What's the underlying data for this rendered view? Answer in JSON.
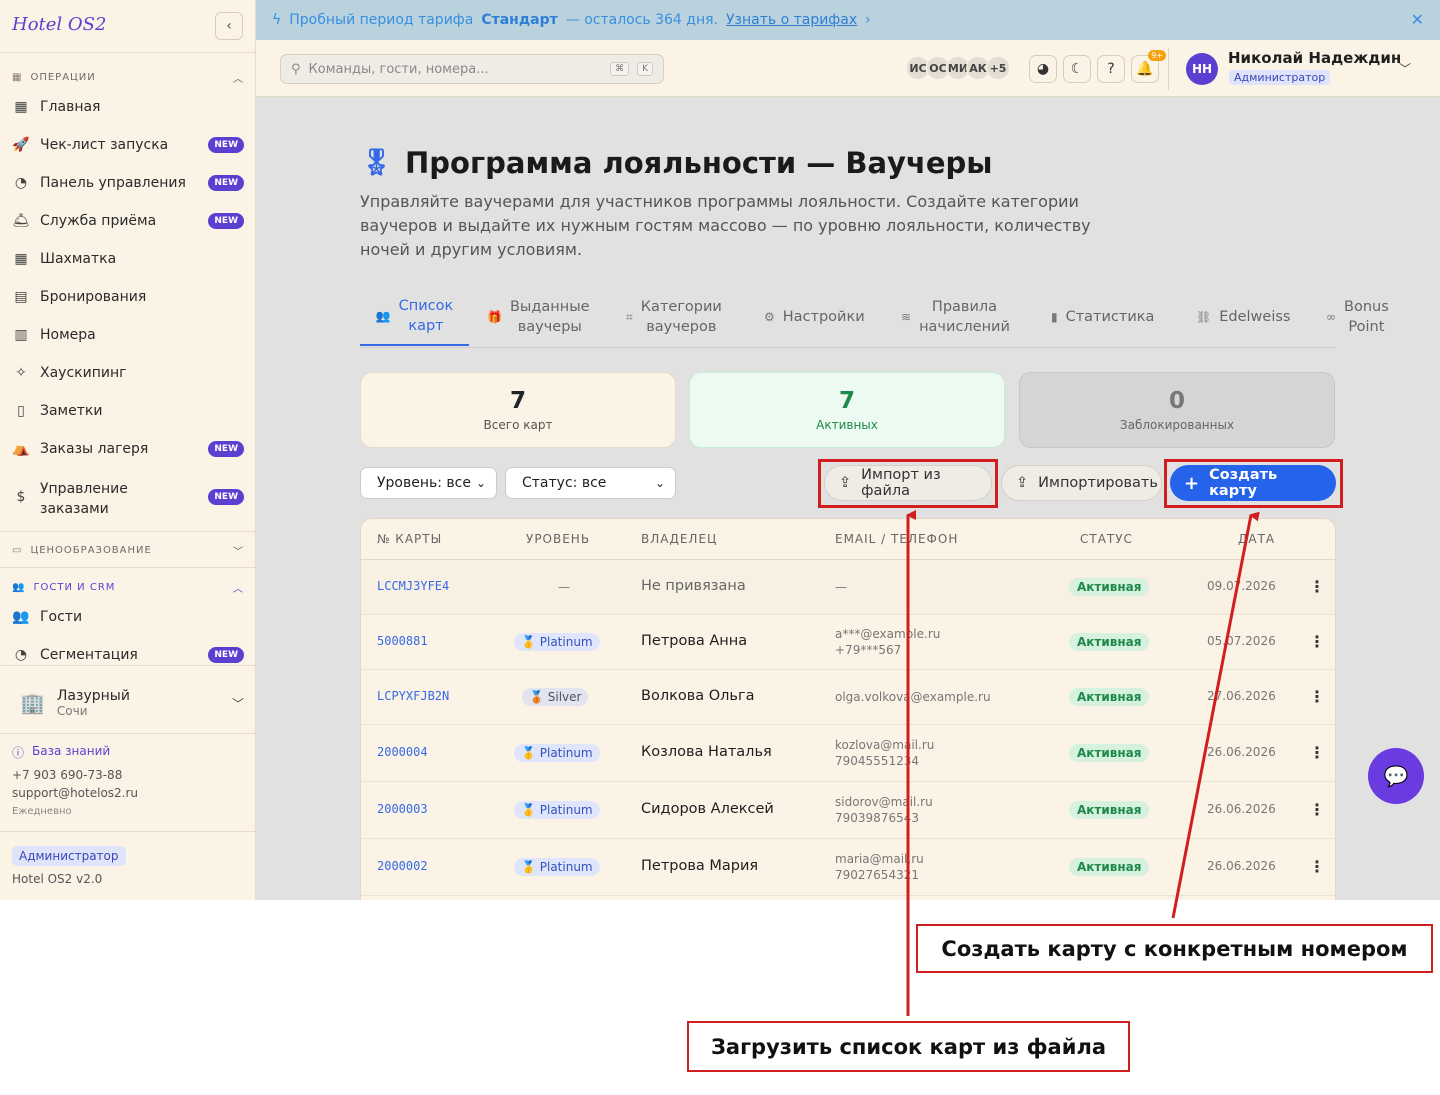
{
  "sidebar": {
    "logo": "Hotel OS2",
    "collapse_icon": "‹",
    "sections": {
      "operations": "ОПЕРАЦИИ",
      "pricing": "ЦЕНООБРАЗОВАНИЕ",
      "guests_crm": "ГОСТИ И CRM"
    },
    "items": [
      {
        "label": "Главная",
        "icon": "grid-icon",
        "badge": ""
      },
      {
        "label": "Чек-лист запуска",
        "icon": "rocket-icon",
        "badge": "NEW"
      },
      {
        "label": "Панель управления",
        "icon": "gauge-icon",
        "badge": "NEW"
      },
      {
        "label": "Служба приёма",
        "icon": "bell-desk-icon",
        "badge": "NEW"
      },
      {
        "label": "Шахматка",
        "icon": "table-icon",
        "badge": ""
      },
      {
        "label": "Бронирования",
        "icon": "clipboard-icon",
        "badge": ""
      },
      {
        "label": "Номера",
        "icon": "building-icon",
        "badge": ""
      },
      {
        "label": "Хаускипинг",
        "icon": "sparkle-icon",
        "badge": ""
      },
      {
        "label": "Заметки",
        "icon": "note-icon",
        "badge": ""
      },
      {
        "label": "Заказы лагеря",
        "icon": "tent-icon",
        "badge": "NEW"
      },
      {
        "label_1": "Управление",
        "label_2": "заказами",
        "icon": "dollar-doc-icon",
        "badge": "NEW"
      },
      {
        "label": "Гости",
        "icon": "users-icon",
        "badge": ""
      },
      {
        "label": "Сегментация",
        "icon": "pie-icon",
        "badge": "NEW"
      }
    ],
    "hotel": {
      "name": "Лазурный",
      "city": "Сочи"
    },
    "help": {
      "kb": "База знаний",
      "phone": "+7 903 690-73-88",
      "email": "support@hotelos2.ru",
      "hours": "Ежедневно"
    },
    "role": "Администратор",
    "version": "Hotel OS2 v2.0"
  },
  "banner": {
    "prefix": "Пробный период тарифа",
    "plan": "Стандарт",
    "suffix": "— осталось 364 дня.",
    "link": "Узнать о тарифах"
  },
  "topbar": {
    "search_placeholder": "Команды, гости, номера...",
    "kbd1": "⌘",
    "kbd2": "K",
    "avatars": [
      "ИС",
      "ОС",
      "МИ",
      "АК",
      "+5"
    ],
    "notif_count": "9+",
    "user_initials": "НН",
    "user_name": "Николай Надеждин",
    "user_role": "Администратор"
  },
  "page": {
    "title": "Программа лояльности — Ваучеры",
    "description": "Управляйте ваучерами для участников программы лояльности. Создайте категории ваучеров и выдайте их нужным гостям массово — по уровню лояльности, количеству ночей и другим условиям."
  },
  "tabs": [
    {
      "l1": "Список",
      "l2": "карт",
      "icon": "users-icon"
    },
    {
      "l1": "Выданные",
      "l2": "ваучеры",
      "icon": "gift-icon"
    },
    {
      "l1": "Категории",
      "l2": "ваучеров",
      "icon": "tag-icon"
    },
    {
      "l1": "Настройки",
      "l2": "",
      "icon": "gear-icon"
    },
    {
      "l1": "Правила",
      "l2": "начислений",
      "icon": "layers-icon"
    },
    {
      "l1": "Статистика",
      "l2": "",
      "icon": "bar-chart-icon"
    },
    {
      "l1": "Edelweiss",
      "l2": "",
      "icon": "link-icon"
    },
    {
      "l1": "Bonus",
      "l2": "Point",
      "icon": "link-icon"
    }
  ],
  "stats": {
    "total": {
      "value": "7",
      "label": "Всего карт"
    },
    "active": {
      "value": "7",
      "label": "Активных"
    },
    "blocked": {
      "value": "0",
      "label": "Заблокированных"
    }
  },
  "filters": {
    "level": "Уровень: все",
    "status": "Статус: все"
  },
  "actions": {
    "import_file": "Импорт из файла",
    "import": "Импортировать",
    "create": "Создать карту"
  },
  "table": {
    "headers": [
      "№ КАРТЫ",
      "УРОВЕНЬ",
      "ВЛАДЕЛЕЦ",
      "EMAIL / ТЕЛЕФОН",
      "СТАТУС",
      "ДАТА"
    ],
    "rows": [
      {
        "card": "LCCMJ3YFE4",
        "level": "—",
        "owner": "Не привязана",
        "c1": "—",
        "c2": "",
        "status": "Активная",
        "date": "09.07.2026"
      },
      {
        "card": "5000881",
        "level": "🥇 Platinum",
        "owner": "Петрова Анна",
        "c1": "a***@example.ru",
        "c2": "+79***567",
        "status": "Активная",
        "date": "05.07.2026"
      },
      {
        "card": "LCPYXFJB2N",
        "level": "🥉 Silver",
        "owner": "Волкова Ольга",
        "c1": "olga.volkova@example.ru",
        "c2": "",
        "status": "Активная",
        "date": "27.06.2026"
      },
      {
        "card": "2000004",
        "level": "🥇 Platinum",
        "owner": "Козлова Наталья",
        "c1": "kozlova@mail.ru",
        "c2": "79045551234",
        "status": "Активная",
        "date": "26.06.2026"
      },
      {
        "card": "2000003",
        "level": "🥇 Platinum",
        "owner": "Сидоров Алексей",
        "c1": "sidorov@mail.ru",
        "c2": "79039876543",
        "status": "Активная",
        "date": "26.06.2026"
      },
      {
        "card": "2000002",
        "level": "🥇 Platinum",
        "owner": "Петрова Мария",
        "c1": "maria@mail.ru",
        "c2": "79027654321",
        "status": "Активная",
        "date": "26.06.2026"
      }
    ]
  },
  "annotations": {
    "create_card": "Создать карту с конкретным номером",
    "import_file": "Загрузить список карт из файла"
  },
  "colors": {
    "accent": "#2563eb",
    "brand": "#5b3fd1",
    "annotation": "#d11f1f"
  }
}
